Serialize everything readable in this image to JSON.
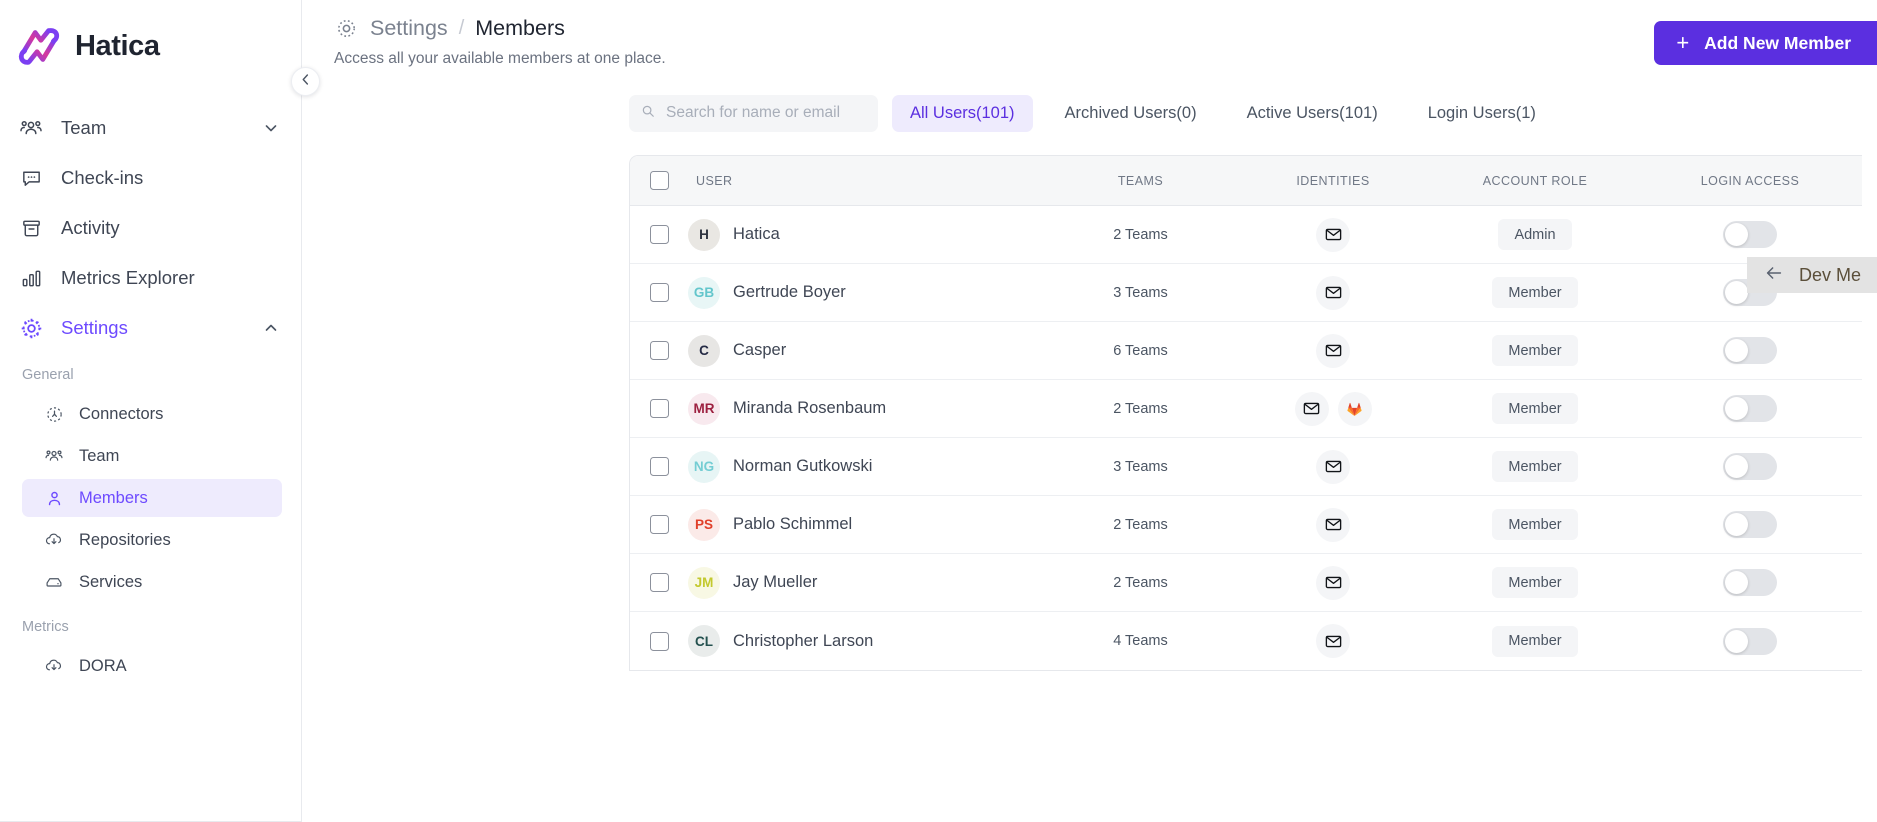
{
  "brand": {
    "name": "Hatica"
  },
  "sidebar": {
    "nav": [
      {
        "label": "Team",
        "icon": "team-icon",
        "chevron": "chevron-down-icon"
      },
      {
        "label": "Check-ins",
        "icon": "chat-icon",
        "chevron": ""
      },
      {
        "label": "Activity",
        "icon": "archive-icon",
        "chevron": ""
      },
      {
        "label": "Metrics Explorer",
        "icon": "bar-chart-icon",
        "chevron": ""
      },
      {
        "label": "Settings",
        "icon": "gear-icon",
        "chevron": "chevron-up-icon"
      }
    ],
    "groups": [
      {
        "label": "General",
        "items": [
          {
            "label": "Connectors",
            "icon": "connectors-icon",
            "selected": false
          },
          {
            "label": "Team",
            "icon": "team-icon",
            "selected": false
          },
          {
            "label": "Members",
            "icon": "person-icon",
            "selected": true
          },
          {
            "label": "Repositories",
            "icon": "cloud-download-icon",
            "selected": false
          },
          {
            "label": "Services",
            "icon": "server-icon",
            "selected": false
          }
        ]
      },
      {
        "label": "Metrics",
        "items": [
          {
            "label": "DORA",
            "icon": "cloud-download-icon",
            "selected": false
          }
        ]
      }
    ]
  },
  "header": {
    "breadcrumb_root": "Settings",
    "breadcrumb_sep": "/",
    "breadcrumb_current": "Members",
    "subtitle": "Access all your available members at one place.",
    "add_button": "Add New Member",
    "add_button_plus": "+"
  },
  "filters": {
    "search_placeholder": "Search for name or email",
    "search_value": "",
    "tabs": [
      {
        "label": "All Users(101)",
        "active": true
      },
      {
        "label": "Archived Users(0)",
        "active": false
      },
      {
        "label": "Active Users(101)",
        "active": false
      },
      {
        "label": "Login Users(1)",
        "active": false
      }
    ]
  },
  "table": {
    "columns": [
      "USER",
      "TEAMS",
      "IDENTITIES",
      "ACCOUNT ROLE",
      "LOGIN ACCESS"
    ],
    "rows": [
      {
        "initials": "H",
        "name": "Hatica",
        "teams": "2 Teams",
        "identities": [
          "email-icon"
        ],
        "role": "Admin",
        "login_on": false,
        "avatar_bg": "#e9e7e3",
        "avatar_fg": "#2e3440"
      },
      {
        "initials": "GB",
        "name": "Gertrude Boyer",
        "teams": "3 Teams",
        "identities": [
          "email-icon"
        ],
        "role": "Member",
        "login_on": false,
        "avatar_bg": "#e8f6f6",
        "avatar_fg": "#63c6cc"
      },
      {
        "initials": "C",
        "name": "Casper",
        "teams": "6 Teams",
        "identities": [
          "email-icon"
        ],
        "role": "Member",
        "login_on": false,
        "avatar_bg": "#e7e6e4",
        "avatar_fg": "#252b45"
      },
      {
        "initials": "MR",
        "name": "Miranda Rosenbaum",
        "teams": "2 Teams",
        "identities": [
          "email-icon",
          "gitlab-icon"
        ],
        "role": "Member",
        "login_on": false,
        "avatar_bg": "#f8e9ee",
        "avatar_fg": "#9d2040"
      },
      {
        "initials": "NG",
        "name": "Norman Gutkowski",
        "teams": "3 Teams",
        "identities": [
          "email-icon"
        ],
        "role": "Member",
        "login_on": false,
        "avatar_bg": "#e7f5f5",
        "avatar_fg": "#74cdd3"
      },
      {
        "initials": "PS",
        "name": "Pablo Schimmel",
        "teams": "2 Teams",
        "identities": [
          "email-icon"
        ],
        "role": "Member",
        "login_on": false,
        "avatar_bg": "#fbeae8",
        "avatar_fg": "#e0402a"
      },
      {
        "initials": "JM",
        "name": "Jay Mueller",
        "teams": "2 Teams",
        "identities": [
          "email-icon"
        ],
        "role": "Member",
        "login_on": false,
        "avatar_bg": "#f8f8e4",
        "avatar_fg": "#c3c92e"
      },
      {
        "initials": "CL",
        "name": "Christopher Larson",
        "teams": "4 Teams",
        "identities": [
          "email-icon"
        ],
        "role": "Member",
        "login_on": false,
        "avatar_bg": "#e9eceb",
        "avatar_fg": "#24514f"
      }
    ]
  },
  "dev_panel": {
    "label": "Dev Me",
    "back_icon": "arrow-left-icon"
  },
  "colors": {
    "accent": "#5b2fe0",
    "accent_soft": "#eeebfd",
    "text": "#3f4654",
    "muted": "#9aa1ae"
  }
}
